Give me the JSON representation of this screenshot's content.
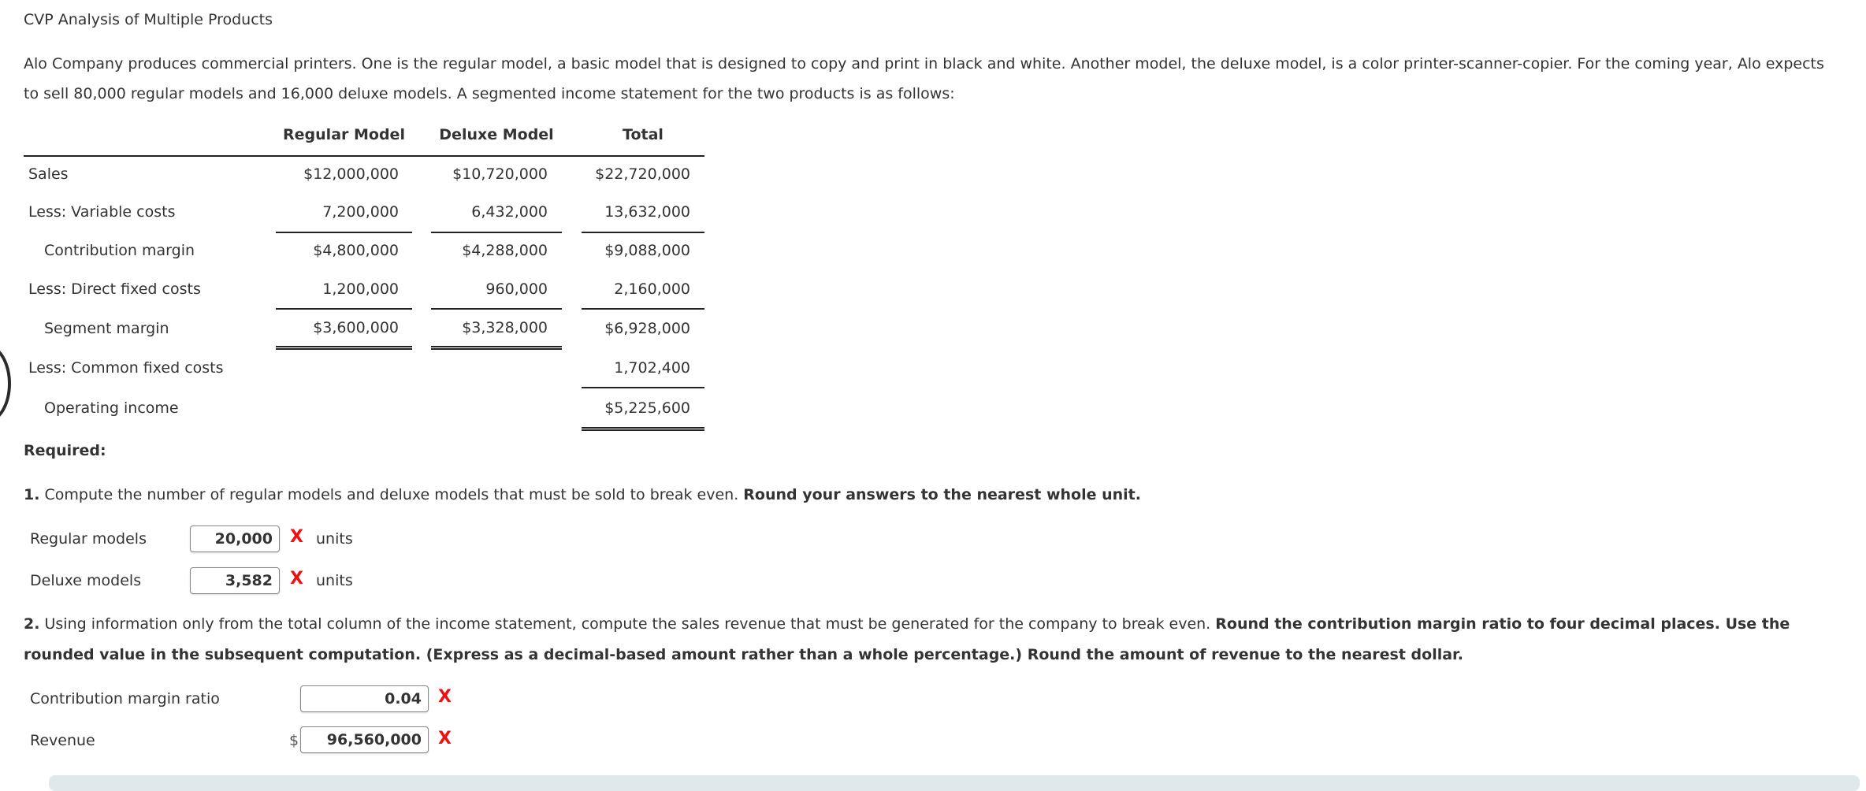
{
  "title": "CVP Analysis of Multiple Products",
  "intro": {
    "line1": "Alo Company produces commercial printers. One is the regular model, a basic model that is designed to copy and print in black and white. Another model, the deluxe model, is a color printer-scanner-copier. For the coming year, Alo expects",
    "line2": "to sell 80,000 regular models and 16,000 deluxe models. A segmented income statement for the two products is as follows:"
  },
  "income_statement": {
    "headers": [
      "Regular Model",
      "Deluxe Model",
      "Total"
    ],
    "rows": [
      {
        "label": "Sales",
        "regular": "$12,000,000",
        "deluxe": "$10,720,000",
        "total": "$22,720,000"
      },
      {
        "label": "Less: Variable costs",
        "regular": "7,200,000",
        "deluxe": "6,432,000",
        "total": "13,632,000"
      },
      {
        "label": "Contribution margin",
        "regular": "$4,800,000",
        "deluxe": "$4,288,000",
        "total": "$9,088,000"
      },
      {
        "label": "Less: Direct fixed costs",
        "regular": "1,200,000",
        "deluxe": "960,000",
        "total": "2,160,000"
      },
      {
        "label": "Segment margin",
        "regular": "$3,600,000",
        "deluxe": "$3,328,000",
        "total": "$6,928,000"
      },
      {
        "label": "Less: Common fixed costs",
        "regular": "",
        "deluxe": "",
        "total": "1,702,400"
      },
      {
        "label": "Operating income",
        "regular": "",
        "deluxe": "",
        "total": "$5,225,600"
      }
    ]
  },
  "required": {
    "heading": "Required:",
    "q1": {
      "number": "1.",
      "text": " Compute the number of regular models and deluxe models that must be sold to break even. ",
      "bold": "Round your answers to the nearest whole unit.",
      "answers": [
        {
          "label": "Regular models",
          "value": "20,000",
          "status": "X",
          "unit": "units"
        },
        {
          "label": "Deluxe models",
          "value": "3,582",
          "status": "X",
          "unit": "units"
        }
      ]
    },
    "q2": {
      "number": "2.",
      "text": " Using information only from the total column of the income statement, compute the sales revenue that must be generated for the company to break even. ",
      "bold1": "Round the contribution margin ratio to four decimal places. Use the",
      "bold2": "rounded value in the subsequent computation. (Express as a decimal-based amount rather than a whole percentage.) Round the amount of revenue to the nearest dollar.",
      "answers": [
        {
          "label": "Contribution margin ratio",
          "prefix": "",
          "value": "0.04",
          "status": "X"
        },
        {
          "label": "Revenue",
          "prefix": "$",
          "value": "96,560,000",
          "status": "X"
        }
      ]
    }
  },
  "colors": {
    "text": "#333333",
    "incorrect": "#ee1111",
    "bottom_bar": "#e1e8ec"
  }
}
